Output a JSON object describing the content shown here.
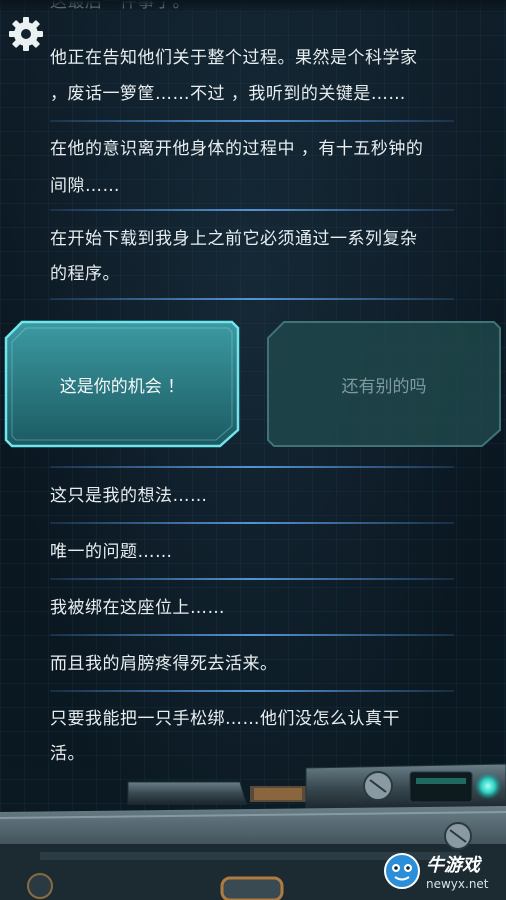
{
  "top_partial_text": "这最后一件事了。",
  "settings": {
    "icon": "gear-icon"
  },
  "dialog_top": [
    {
      "text": "他正在告知他们关于整个过程。果然是个科学家"
    },
    {
      "text": "，废话一箩筐……不过  ，我听到的关键是……"
    },
    {
      "text": "在他的意识离开他身体的过程中  ，有十五秒钟的"
    },
    {
      "text": "间隙……"
    },
    {
      "text": "在开始下载到我身上之前它必须通过一系列复杂"
    },
    {
      "text": "的程序。"
    }
  ],
  "choices": [
    {
      "label": "这是你的机会  ！",
      "state": "active"
    },
    {
      "label": "还有别的吗",
      "state": "inactive"
    }
  ],
  "dialog_bottom": [
    {
      "text": "这只是我的想法……"
    },
    {
      "text": "唯一的问题……"
    },
    {
      "text": "我被绑在这座位上……"
    },
    {
      "text": "而且我的肩膀疼得死去活来。"
    },
    {
      "text": "只要我能把一只手松绑……他们没怎么认真干"
    },
    {
      "text": "活。"
    }
  ],
  "watermark": {
    "cn": "牛游戏",
    "en": "newyx.net"
  },
  "colors": {
    "accent_cyan": "#3fd0d8",
    "separator_blue": "#5aa0e6",
    "button_active": "#2f8a92",
    "button_inactive": "#1f4a4e"
  }
}
